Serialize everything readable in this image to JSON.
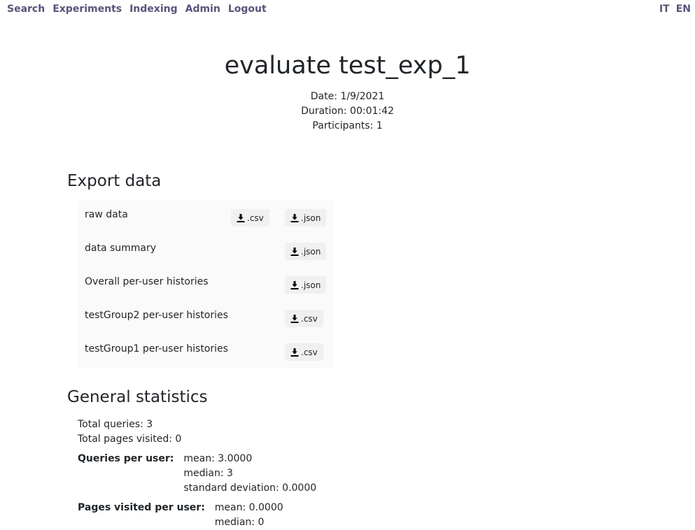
{
  "nav": {
    "left": [
      "Search",
      "Experiments",
      "Indexing",
      "Admin",
      "Logout"
    ],
    "right": [
      "IT",
      "EN"
    ]
  },
  "header": {
    "title": "evaluate test_exp_1",
    "date": "Date: 1/9/2021",
    "duration": "Duration: 00:01:42",
    "participants": "Participants: 1"
  },
  "export": {
    "heading": "Export data",
    "rows": [
      {
        "label": "raw data",
        "buttons": [
          ".csv",
          ".json"
        ]
      },
      {
        "label": "data summary",
        "buttons": [
          ".json"
        ]
      },
      {
        "label": "Overall per-user histories",
        "buttons": [
          ".json"
        ]
      },
      {
        "label": "testGroup2 per-user histories",
        "buttons": [
          ".csv"
        ]
      },
      {
        "label": "testGroup1 per-user histories",
        "buttons": [
          ".csv"
        ]
      }
    ],
    "icon": "download-icon"
  },
  "stats": {
    "heading": "General statistics",
    "total_queries": "Total queries: 3",
    "total_pages": "Total pages visited: 0",
    "queries_per_user": {
      "label": "Queries per user:",
      "mean": "mean: 3.0000",
      "median": "median: 3",
      "sd": "standard deviation: 0.0000"
    },
    "pages_per_user": {
      "label": "Pages visited per user:",
      "mean": "mean: 0.0000",
      "median": "median: 0"
    }
  },
  "colors": {
    "nav_link": "#55557a",
    "text": "#212529",
    "export_bg": "#fafafa",
    "button_bg": "#f0f0f0"
  }
}
